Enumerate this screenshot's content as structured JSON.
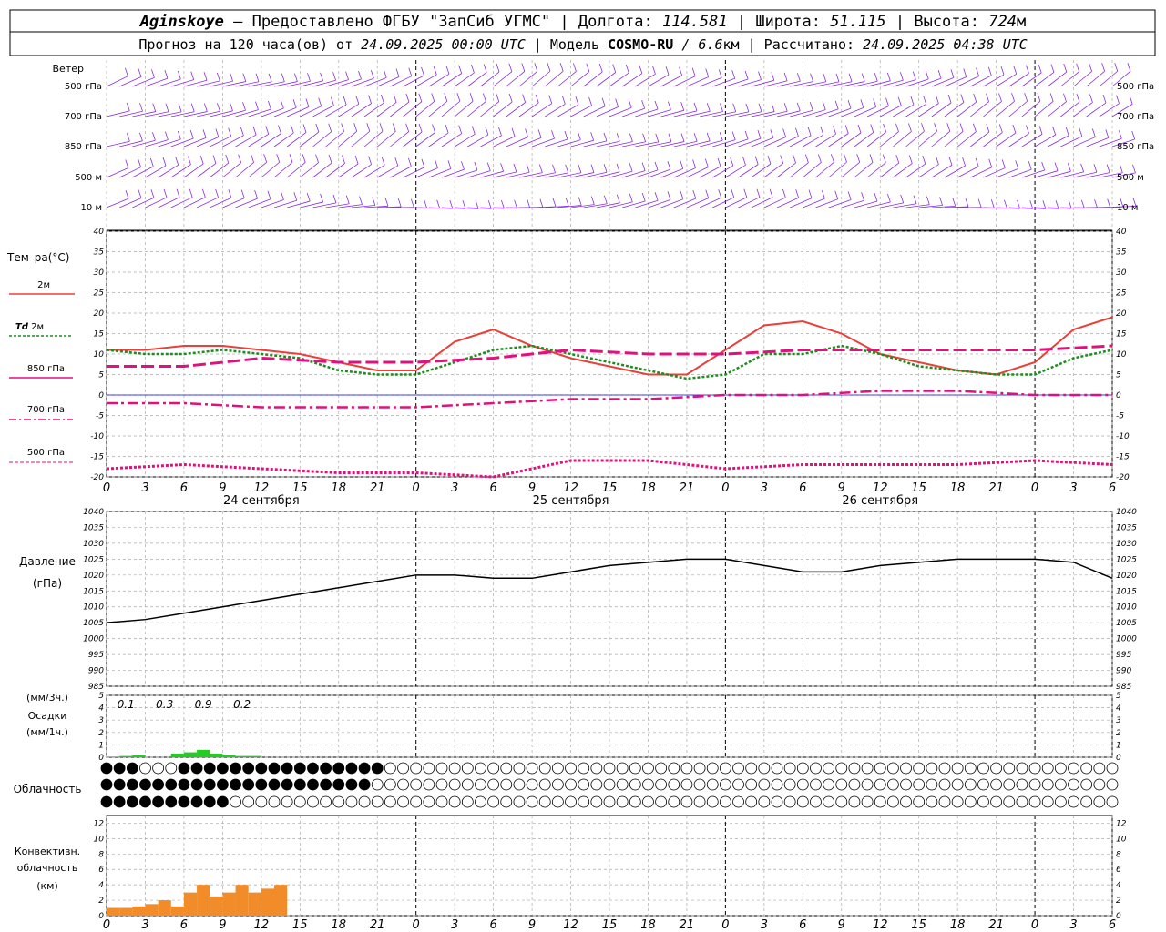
{
  "header": {
    "station": "Aginskoye",
    "provider": " – Предоставлено ФГБУ \"ЗапСиб УГМС\" | Долгота: ",
    "lon": "114.581",
    "lat_label": " | Широта: ",
    "lat": "51.115",
    "alt_label": " | Высота: ",
    "alt": "724",
    "alt_unit": "м",
    "forecast_label": "Прогноз на 120 часа(ов) от ",
    "forecast_time": "24.09.2025 00:00 UTC",
    "model_label": " | Модель ",
    "model": "COSMO-RU",
    "model_res": " / 6.6",
    "res_unit": "км",
    "calc_label": " | Рассчитано: ",
    "calc_time": "24.09.2025 04:38 UTC"
  },
  "labels": {
    "wind": "Ветер",
    "levels": [
      "500 гПа",
      "700 гПа",
      "850 гПа",
      "500 м",
      "10 м"
    ],
    "temp": "Тем–ра(°C)",
    "t2m": "2м",
    "td": "Td",
    "td2m": "2м",
    "t850": "850 гПа",
    "t700": "700 гПа",
    "t500": "500 гПа",
    "pressure": "Давление",
    "pressure_unit": "(гПа)",
    "precip_top": "(мм/3ч.)",
    "precip": "Осадки",
    "precip_bottom": "(мм/1ч.)",
    "clouds": "Облачность",
    "conv1": "Конвективн.",
    "conv2": "облачность",
    "conv3": "(км)"
  },
  "colors": {
    "t2m": "#e8403a",
    "td": "#1e8c1e",
    "t850": "#e0107e",
    "t700": "#e0107e",
    "t500": "#e0107e",
    "wind": "#8a2be2",
    "precip": "#22cc22",
    "conv": "#f28c28",
    "pressure": "#000000"
  },
  "chart_data": {
    "type": "line",
    "x_unit": "hours since 24.09.2025 00:00 UTC",
    "x_ticks": [
      "0",
      "3",
      "6",
      "9",
      "12",
      "15",
      "18",
      "21",
      "0",
      "3",
      "6",
      "9",
      "12",
      "15",
      "18",
      "21",
      "0",
      "3",
      "6",
      "9",
      "12",
      "15",
      "18",
      "21",
      "0",
      "3",
      "6"
    ],
    "dates": [
      "24 сентября",
      "25 сентября",
      "26 сентября"
    ],
    "temperature": {
      "ylim": [
        -20,
        40
      ],
      "yticks": [
        "40",
        "35",
        "30",
        "25",
        "20",
        "15",
        "10",
        "5",
        "0",
        "-5",
        "-10",
        "-15",
        "-20"
      ],
      "series": [
        {
          "name": "2м",
          "x": [
            0,
            3,
            6,
            9,
            12,
            15,
            18,
            21,
            24,
            27,
            30,
            33,
            36,
            39,
            42,
            45,
            48,
            51,
            54,
            57,
            60,
            63,
            66,
            69,
            72,
            75,
            78
          ],
          "values": [
            11,
            11,
            12,
            12,
            11,
            10,
            8,
            6,
            6,
            13,
            16,
            12,
            9,
            7,
            5,
            5,
            11,
            17,
            18,
            15,
            10,
            8,
            6,
            5,
            8,
            16,
            19
          ]
        },
        {
          "name": "Td 2м",
          "x": [
            0,
            3,
            6,
            9,
            12,
            15,
            18,
            21,
            24,
            27,
            30,
            33,
            36,
            39,
            42,
            45,
            48,
            51,
            54,
            57,
            60,
            63,
            66,
            69,
            72,
            75,
            78
          ],
          "values": [
            11,
            10,
            10,
            11,
            10,
            9,
            6,
            5,
            5,
            8,
            11,
            12,
            10,
            8,
            6,
            4,
            5,
            10,
            10,
            12,
            10,
            7,
            6,
            5,
            5,
            9,
            11
          ]
        },
        {
          "name": "850 гПа",
          "x": [
            0,
            6,
            12,
            18,
            24,
            30,
            36,
            42,
            48,
            54,
            60,
            66,
            72,
            78
          ],
          "values": [
            7,
            7,
            9,
            8,
            8,
            9,
            11,
            10,
            10,
            11,
            11,
            11,
            11,
            12
          ]
        },
        {
          "name": "700 гПа",
          "x": [
            0,
            6,
            12,
            18,
            24,
            30,
            36,
            42,
            48,
            54,
            60,
            66,
            72,
            78
          ],
          "values": [
            -2,
            -2,
            -3,
            -3,
            -3,
            -2,
            -1,
            -1,
            0,
            0,
            1,
            1,
            0,
            0
          ]
        },
        {
          "name": "500 гПа",
          "x": [
            0,
            6,
            12,
            18,
            24,
            30,
            36,
            42,
            48,
            54,
            60,
            66,
            72,
            78
          ],
          "values": [
            -18,
            -17,
            -18,
            -19,
            -19,
            -20,
            -16,
            -16,
            -18,
            -17,
            -17,
            -17,
            -16,
            -17
          ]
        }
      ]
    },
    "pressure": {
      "ylim": [
        985,
        1040
      ],
      "yticks": [
        "1040",
        "1035",
        "1030",
        "1025",
        "1020",
        "1015",
        "1010",
        "1005",
        "1000",
        "995",
        "990",
        "985"
      ],
      "x": [
        0,
        3,
        6,
        9,
        12,
        15,
        18,
        21,
        24,
        27,
        30,
        33,
        36,
        39,
        42,
        45,
        48,
        51,
        54,
        57,
        60,
        63,
        66,
        69,
        72,
        75,
        78
      ],
      "values": [
        1005,
        1006,
        1008,
        1010,
        1012,
        1014,
        1016,
        1018,
        1020,
        1020,
        1019,
        1019,
        1021,
        1023,
        1024,
        1025,
        1025,
        1023,
        1021,
        1021,
        1023,
        1024,
        1025,
        1025,
        1025,
        1024,
        1019
      ]
    },
    "precip": {
      "ylim": [
        0,
        5
      ],
      "yticks": [
        "5",
        "4",
        "3",
        "2",
        "1",
        "0"
      ],
      "labels3h": [
        {
          "x": 1.5,
          "text": "0.1"
        },
        {
          "x": 4.5,
          "text": "0.3"
        },
        {
          "x": 7.5,
          "text": "0.9"
        },
        {
          "x": 10.5,
          "text": "0.2"
        }
      ],
      "hourly_x": [
        0,
        1,
        2,
        3,
        4,
        5,
        6,
        7,
        8,
        9,
        10,
        11
      ],
      "hourly_values": [
        0.05,
        0.1,
        0.15,
        0,
        0,
        0.3,
        0.4,
        0.6,
        0.3,
        0.2,
        0.1,
        0.1
      ]
    },
    "conv": {
      "ylim": [
        0,
        13
      ],
      "yticks": [
        "12",
        "10",
        "8",
        "6",
        "4",
        "2",
        "0"
      ],
      "x": [
        0,
        1,
        2,
        3,
        4,
        5,
        6,
        7,
        8,
        9,
        10,
        11,
        12,
        13
      ],
      "values": [
        1,
        1,
        1.2,
        1.5,
        2,
        1.2,
        3,
        4,
        2.5,
        3,
        4,
        3,
        3.5,
        4
      ]
    }
  }
}
